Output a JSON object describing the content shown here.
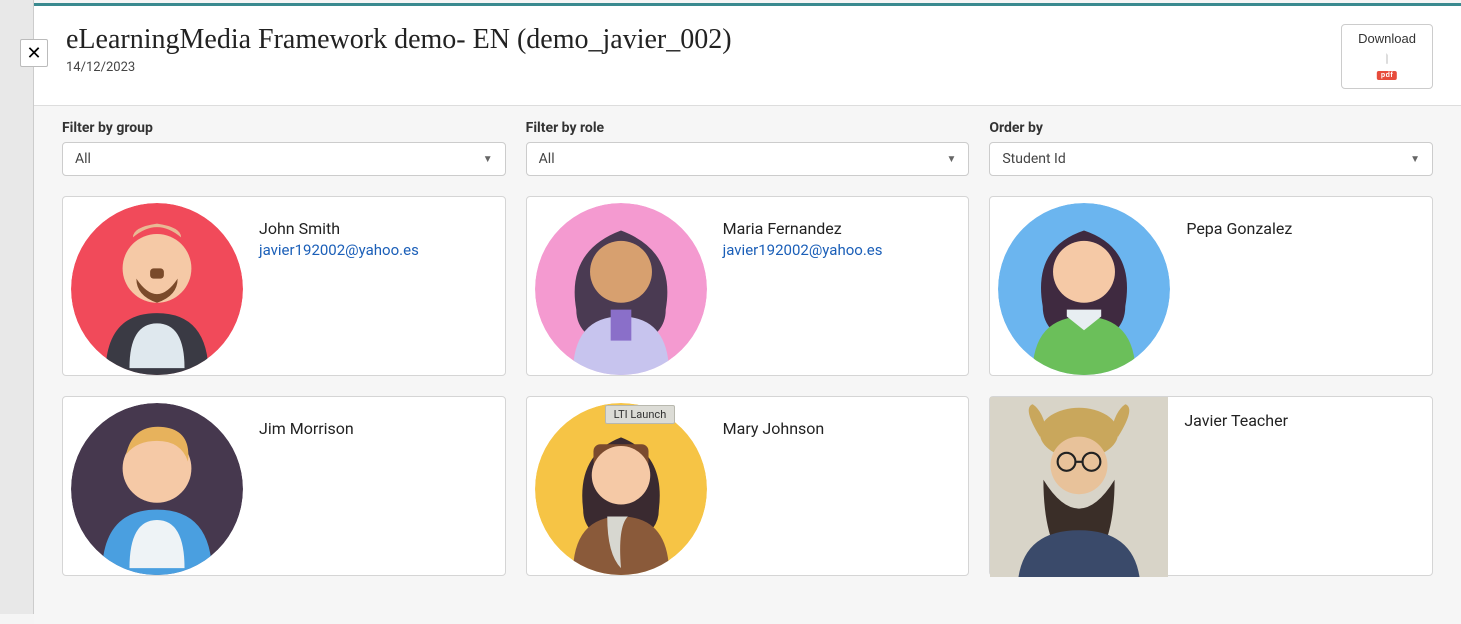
{
  "header": {
    "title": "eLearningMedia Framework demo- EN (demo_javier_002)",
    "date": "14/12/2023",
    "download_label": "Download",
    "pdf_badge": "pdf"
  },
  "filters": {
    "group": {
      "label": "Filter by group",
      "value": "All"
    },
    "role": {
      "label": "Filter by role",
      "value": "All"
    },
    "order": {
      "label": "Order by",
      "value": "Student Id"
    }
  },
  "tooltip": "LTI Launch",
  "students": [
    {
      "name": "John Smith",
      "email": "javier192002@yahoo.es"
    },
    {
      "name": "Maria Fernandez",
      "email": "javier192002@yahoo.es"
    },
    {
      "name": "Pepa Gonzalez",
      "email": ""
    },
    {
      "name": "Jim Morrison",
      "email": ""
    },
    {
      "name": "Mary Johnson",
      "email": ""
    },
    {
      "name": "Javier Teacher",
      "email": ""
    }
  ]
}
